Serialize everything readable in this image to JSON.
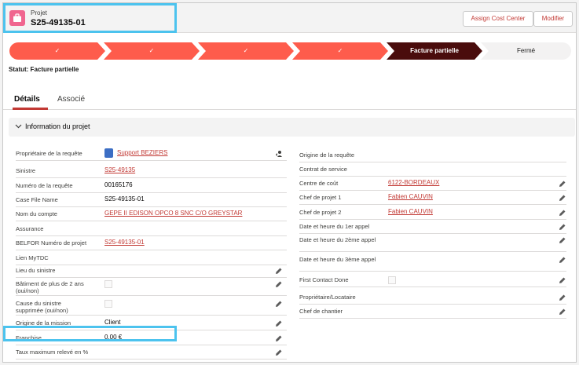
{
  "header": {
    "object_type": "Projet",
    "record_name": "S25-49135-01",
    "buttons": [
      "Assign Cost Center",
      "Modifier"
    ]
  },
  "path": {
    "stages": [
      {
        "label": "✓",
        "state": "done"
      },
      {
        "label": "✓",
        "state": "done"
      },
      {
        "label": "✓",
        "state": "done"
      },
      {
        "label": "✓",
        "state": "done"
      },
      {
        "label": "Facture partielle",
        "state": "current"
      },
      {
        "label": "Fermé",
        "state": "todo"
      }
    ],
    "status_text": "Statut: Facture partielle"
  },
  "tabs": [
    "Détails",
    "Associé"
  ],
  "section_title": "Information du projet",
  "left_fields": [
    {
      "label": "Propriétaire de la requête",
      "value": "Support BEZIERS",
      "link": true
    },
    {
      "label": "Sinistre",
      "value": "S25-49135",
      "link": true
    },
    {
      "label": "Numéro de la requête",
      "value": "00165176"
    },
    {
      "label": "Case File Name",
      "value": "S25-49135-01"
    },
    {
      "label": "Nom du compte",
      "value": "GEPE II EDISON OPCO 8 SNC C/O GREYSTAR",
      "link": true
    },
    {
      "label": "Assurance",
      "value": ""
    },
    {
      "label": "BELFOR Numéro de projet",
      "value": "S25-49135-01",
      "link": true
    },
    {
      "label": "Lien MyTDC",
      "value": ""
    },
    {
      "label": "Lieu du sinistre",
      "value": ""
    },
    {
      "label": "Bâtiment de plus de 2 ans (oui/non)",
      "value": ""
    },
    {
      "label": "Cause du sinistre supprimée (oui/non)",
      "value": ""
    },
    {
      "label": "Origine de la mission",
      "value": "Client"
    },
    {
      "label": "Franchise",
      "value": "0,00 €"
    },
    {
      "label": "Taux maximum relevé en %",
      "value": ""
    }
  ],
  "right_fields": [
    {
      "label": "Origine de la requête",
      "value": ""
    },
    {
      "label": "Contrat de service",
      "value": ""
    },
    {
      "label": "Centre de coût",
      "value": "6122-BORDEAUX",
      "link": true
    },
    {
      "label": "Chef de projet 1",
      "value": "Fabien CAUVIN",
      "link": true
    },
    {
      "label": "Chef de projet 2",
      "value": "Fabien CAUVIN",
      "link": true
    },
    {
      "label": "Date et heure du 1er appel",
      "value": ""
    },
    {
      "label": "Date et heure du 2ème appel",
      "value": ""
    },
    {
      "label": "Date et heure du 3ème appel",
      "value": ""
    },
    {
      "label": "First Contact Done",
      "value": ""
    },
    {
      "label": "Propriétaire/Locataire",
      "value": ""
    },
    {
      "label": "Chef de chantier",
      "value": ""
    }
  ],
  "colors": {
    "path_done": "#fe5c4c",
    "path_current": "#4a0c0c",
    "path_todo": "#f3f2f2",
    "link": "#c23934",
    "highlight": "#4cc3ee",
    "icon_bg": "#f0658f"
  },
  "icons": [
    "briefcase-icon",
    "check-icon",
    "chevron-down-icon",
    "pencil-icon",
    "change-owner-icon",
    "user-avatar-icon"
  ]
}
